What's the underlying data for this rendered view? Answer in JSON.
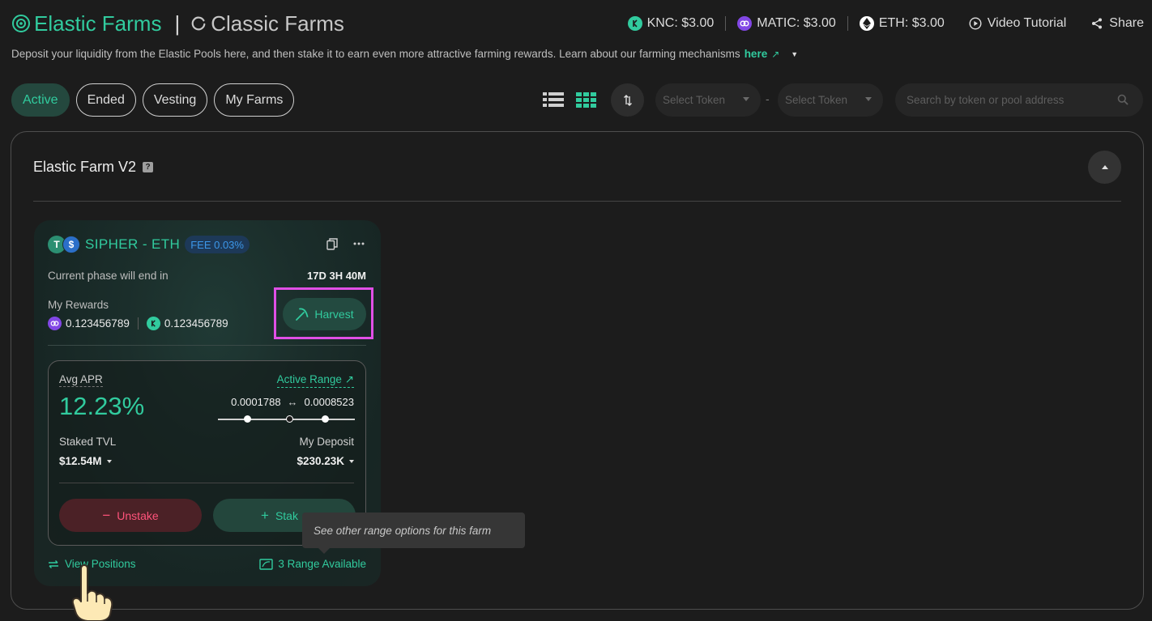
{
  "header": {
    "elastic_title": "Elastic Farms",
    "separator": "|",
    "classic_title": "Classic Farms",
    "prices": [
      {
        "label": "KNC: $3.00",
        "icon": "knc-coin-icon",
        "color": "#31cb9e"
      },
      {
        "label": "MATIC: $3.00",
        "icon": "matic-coin-icon",
        "color": "#8247e5"
      },
      {
        "label": "ETH: $3.00",
        "icon": "eth-coin-icon",
        "color": "#ffffff"
      }
    ],
    "video_tutorial": "Video Tutorial",
    "share": "Share"
  },
  "subtitle": {
    "text": "Deposit your liquidity from the Elastic Pools here, and then stake it to earn even more attractive farming rewards. Learn about our farming mechanisms",
    "link": "here",
    "link_arrow": "↗"
  },
  "tabs": [
    {
      "label": "Active",
      "active": true
    },
    {
      "label": "Ended",
      "active": false
    },
    {
      "label": "Vesting",
      "active": false
    },
    {
      "label": "My Farms",
      "active": false
    }
  ],
  "filters": {
    "select_token_a": "Select Token",
    "dash": "-",
    "select_token_b": "Select Token",
    "search_placeholder": "Search by token or pool address"
  },
  "panel": {
    "title": "Elastic Farm V2",
    "help": "?"
  },
  "farm": {
    "token_a_symbol": "T",
    "token_b_symbol": "$",
    "pair": "SIPHER - ETH",
    "fee": "FEE 0.03%",
    "phase_label": "Current phase will end in",
    "phase_value": "17D 3H 40M",
    "rewards_label": "My Rewards",
    "reward_1": "0.123456789",
    "reward_2": "0.123456789",
    "harvest": "Harvest",
    "apr_label": "Avg APR",
    "apr_value": "12.23%",
    "active_range": "Active Range",
    "active_range_arrow": "↗",
    "range_min": "0.0001788",
    "range_arrow": "↔",
    "range_max": "0.0008523",
    "staked_tvl_label": "Staked TVL",
    "staked_tvl_value": "$12.54M",
    "my_deposit_label": "My Deposit",
    "my_deposit_value": "$230.23K",
    "unstake": "Unstake",
    "unstake_icon": "−",
    "stake": "Stak",
    "stake_icon": "+",
    "view_positions": "View Positions",
    "range_available": "3 Range Available"
  },
  "tooltip": {
    "text": "See other range options for this farm"
  },
  "colors": {
    "accent": "#31cb9e",
    "danger": "#ff537b",
    "highlight": "#e04fe6",
    "fee_blue": "#3c97e9"
  }
}
